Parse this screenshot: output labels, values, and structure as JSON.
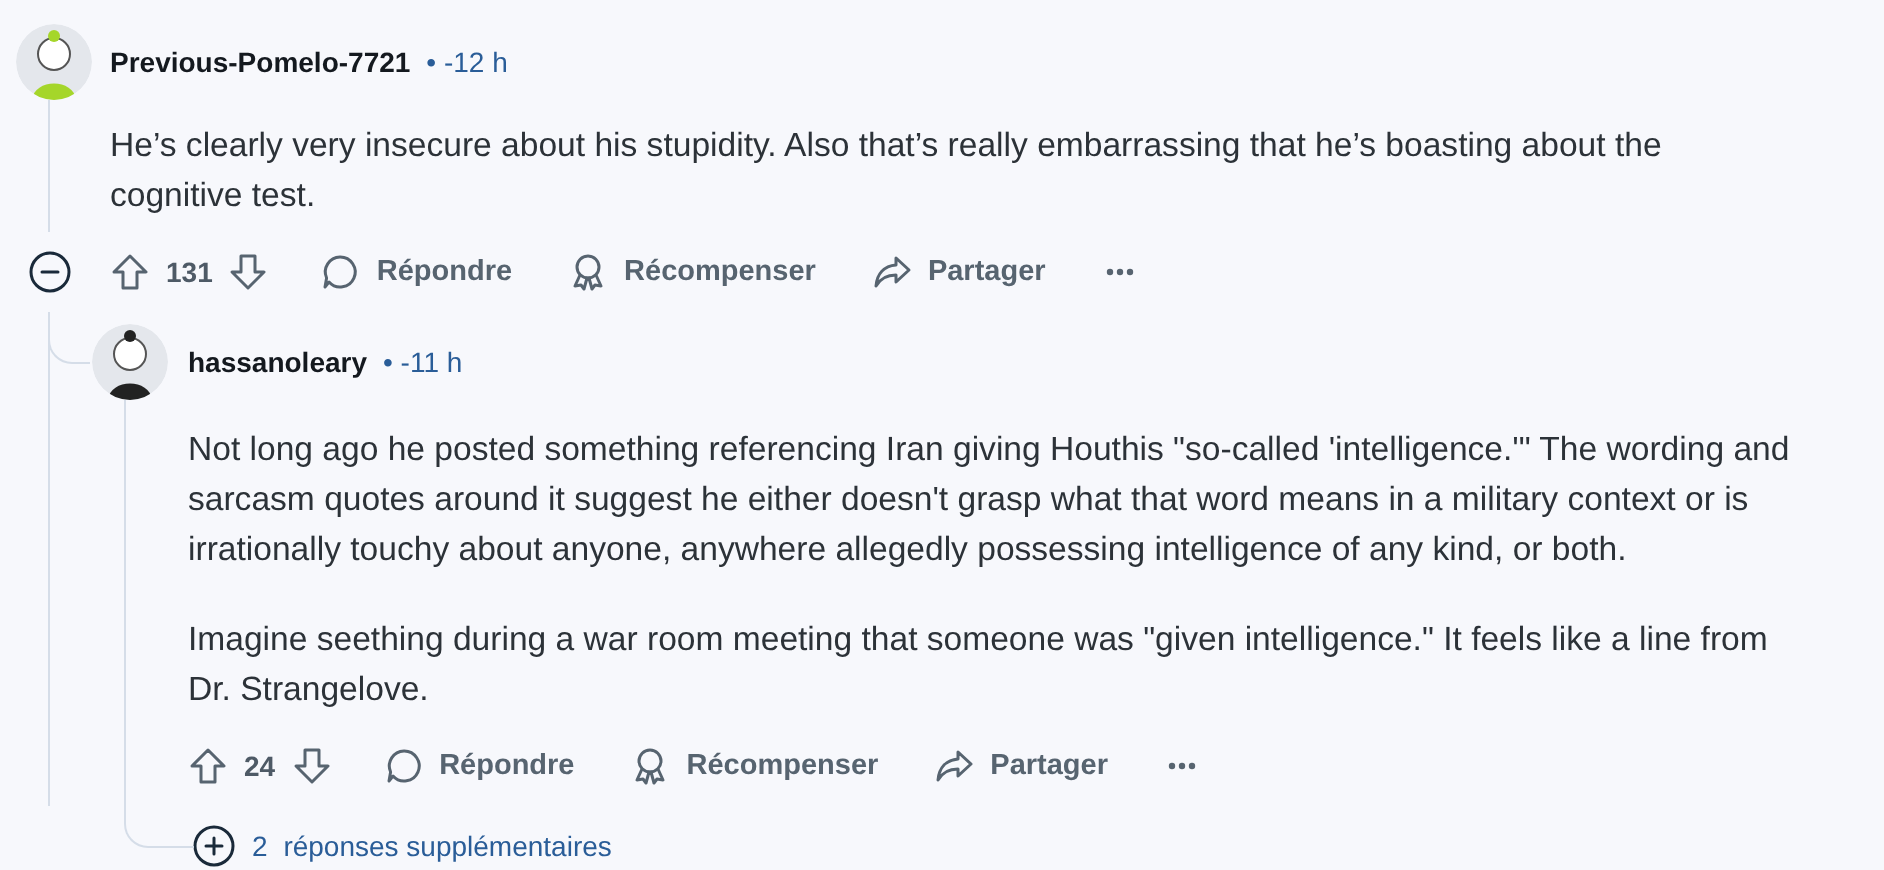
{
  "comment": {
    "author": "Previous-Pomelo-7721",
    "time": "• -12 h",
    "expanded": true,
    "paragraphs": [
      "He’s clearly very insecure about his stupidity. Also that’s really embarrassing that he’s boasting about the cognitive test."
    ],
    "votes": "131",
    "actions": [
      {
        "kind": "reply",
        "label": "Répondre"
      },
      {
        "kind": "award",
        "label": "Récompenser"
      },
      {
        "kind": "share",
        "label": "Partager"
      },
      {
        "kind": "more"
      }
    ],
    "replies": [
      {
        "author": "hassanoleary",
        "time": "• -11 h",
        "paragraphs": [
          "Not long ago he posted something referencing Iran giving Houthis \"so-called 'intelligence.'\" The wording and sarcasm quotes around it suggest he either doesn't grasp what that word means in a military context or is irrationally touchy about anyone, anywhere allegedly possessing intelligence of any kind, or both.",
          "Imagine seething during a war room meeting that someone was \"given intelligence.\" It feels like a line from Dr. Strangelove."
        ],
        "votes": "24",
        "actions": [
          {
            "kind": "reply",
            "label": "Répondre"
          },
          {
            "kind": "award",
            "label": "Récompenser"
          },
          {
            "kind": "share",
            "label": "Partager"
          },
          {
            "kind": "more"
          }
        ],
        "more_replies": {
          "count": "2",
          "label": "réponses supplémentaires"
        }
      }
    ]
  }
}
